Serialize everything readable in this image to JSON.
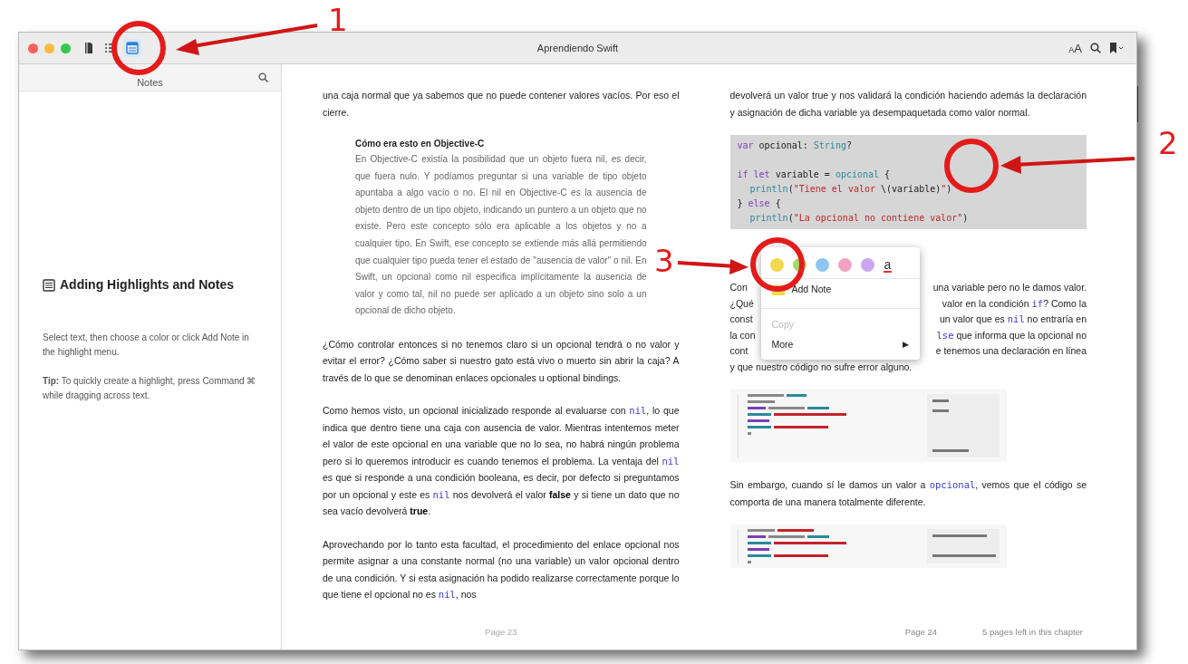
{
  "window": {
    "title": "Aprendiendo Swift"
  },
  "toolbar": {
    "buttons": [
      {
        "kind": "library",
        "selected": false
      },
      {
        "kind": "contents",
        "selected": false
      },
      {
        "kind": "notes",
        "selected": true
      }
    ],
    "font_button": "AA"
  },
  "sidebar": {
    "title": "Notes",
    "heading": "Adding Highlights and Notes",
    "body": "Select text, then choose a color or click Add Note in the highlight menu.",
    "tip": "**Tip:** To quickly create a highlight, press Command ⌘ while dragging across text."
  },
  "left_page": {
    "blocks": [
      {
        "kind": "paragraph",
        "segments": [
          {
            "kind": "plain",
            "text": "una caja normal que ya sabemos que no puede contener valores vacíos. Por eso el cierre."
          }
        ]
      },
      {
        "kind": "aside",
        "title": "Cómo era esto en Objective-C",
        "body": "En Objective-C existía la posibilidad que un objeto fuera nil, es decir, que fuera nulo. Y podíamos preguntar si una variable de tipo objeto apuntaba a algo vacío o no. El nil en Objective-C es la ausencia de objeto dentro de un tipo objeto, indicando un puntero a un objeto que no existe. Pero este concepto sólo era aplicable a los objetos y no a cualquier tipo. En Swift, ese concepto se extiende más allá permitiendo que cualquier tipo pueda tener el estado de \"ausencia de valor\" o nil. En Swift, un opcional como nil especifica implícitamente la ausencia de valor y como tal, nil no puede ser aplicado a un objeto sino solo a un opcional de dicho objeto."
      },
      {
        "kind": "paragraph",
        "segments": [
          {
            "kind": "plain",
            "text": "¿Cómo controlar entonces si no tenemos claro si un opcional tendrá o no valor y evitar el error? ¿Cómo saber si nuestro gato está vivo o muerto sin abrir la caja? A través de lo que se denominan enlaces opcionales u optional bindings."
          }
        ]
      },
      {
        "kind": "paragraph",
        "segments": [
          {
            "kind": "plain",
            "text": "Como hemos visto, un opcional inicializado responde al evaluarse con "
          },
          {
            "kind": "code",
            "text": "nil"
          },
          {
            "kind": "plain",
            "text": ", lo que indica que dentro tiene una caja con ausencia de valor. Mientras intentemos meter el valor de este opcional en una variable que no lo sea, no habrá ningún problema pero si lo queremos introducir es cuando tenemos el problema. La ventaja del "
          },
          {
            "kind": "code",
            "text": "nil"
          },
          {
            "kind": "plain",
            "text": " es que si responde a una condición booleana, es decir, por defecto si preguntamos por un opcional y este es "
          },
          {
            "kind": "code",
            "text": "nil"
          },
          {
            "kind": "plain",
            "text": " nos devolverá el valor "
          },
          {
            "kind": "bold",
            "text": "false"
          },
          {
            "kind": "plain",
            "text": " y si tiene un dato que no sea vacío devolverá "
          },
          {
            "kind": "bold",
            "text": "true"
          },
          {
            "kind": "plain",
            "text": "."
          }
        ]
      },
      {
        "kind": "paragraph",
        "segments": [
          {
            "kind": "plain",
            "text": "Aprovechando por lo tanto esta facultad, el procedimiento del enlace opcional nos permite asignar a una constante normal (no una variable) un valor opcional dentro de una condición. Y si esta asignación ha podido realizarse correctamente porque lo que tiene el opcional no es "
          },
          {
            "kind": "code",
            "text": "nil"
          },
          {
            "kind": "plain",
            "text": ", nos"
          }
        ]
      }
    ],
    "footer": "Page 23"
  },
  "right_page": {
    "blocks": [
      {
        "kind": "paragraph",
        "segments": [
          {
            "kind": "plain",
            "text": "devolverá un valor true y nos validará la condición haciendo además la declaración y asignación de dicha variable ya desempaquetada como valor normal."
          }
        ]
      },
      {
        "kind": "code",
        "lines": [
          {
            "kind": "code",
            "indent": false,
            "segments": [
              {
                "kind": "keyword",
                "text": "var"
              },
              {
                "kind": "plain",
                "text": " opcional: "
              },
              {
                "kind": "type",
                "text": "String"
              },
              {
                "kind": "plain",
                "text": "?"
              }
            ]
          },
          {
            "kind": "blank"
          },
          {
            "kind": "code",
            "indent": false,
            "segments": [
              {
                "kind": "keyword",
                "text": "if let"
              },
              {
                "kind": "plain",
                "text": " variable = "
              },
              {
                "kind": "type",
                "text": "opcional"
              },
              {
                "kind": "plain",
                "text": " {"
              }
            ]
          },
          {
            "kind": "code",
            "indent": true,
            "segments": [
              {
                "kind": "type",
                "text": "println"
              },
              {
                "kind": "plain",
                "text": "("
              },
              {
                "kind": "string",
                "text": "\"Tiene el valor "
              },
              {
                "kind": "plain",
                "text": "\\(variable)"
              },
              {
                "kind": "string",
                "text": "\""
              },
              {
                "kind": "plain",
                "text": ")"
              }
            ]
          },
          {
            "kind": "code",
            "indent": false,
            "segments": [
              {
                "kind": "plain",
                "text": "} "
              },
              {
                "kind": "keyword",
                "text": "else"
              },
              {
                "kind": "plain",
                "text": " {"
              }
            ]
          },
          {
            "kind": "code",
            "indent": true,
            "segments": [
              {
                "kind": "type",
                "text": "println"
              },
              {
                "kind": "plain",
                "text": "("
              },
              {
                "kind": "string",
                "text": "\"La opcional no contiene valor\""
              },
              {
                "kind": "plain",
                "text": ")"
              }
            ]
          }
        ]
      },
      {
        "kind": "covered",
        "lines": [
          {
            "left": "Con",
            "right": [
              {
                "kind": "plain",
                "text": "una variable pero no le damos valor."
              }
            ]
          },
          {
            "left": "¿Qué",
            "right": [
              {
                "kind": "plain",
                "text": "valor en la condición "
              },
              {
                "kind": "code",
                "text": "if"
              },
              {
                "kind": "plain",
                "text": "? Como la"
              }
            ]
          },
          {
            "left": "const",
            "right": [
              {
                "kind": "plain",
                "text": "un valor que es "
              },
              {
                "kind": "code",
                "text": "nil"
              },
              {
                "kind": "plain",
                "text": " no entraría en"
              }
            ]
          },
          {
            "left": "la con",
            "right": [
              {
                "kind": "code",
                "text": "lse"
              },
              {
                "kind": "plain",
                "text": " que informa que la opcional no"
              }
            ]
          },
          {
            "left": "cont",
            "right": [
              {
                "kind": "plain",
                "text": "e tenemos una declaración en línea"
              }
            ]
          },
          {
            "left": "y que nuestro código no sufre error alguno."
          }
        ]
      },
      {
        "kind": "screenshot"
      },
      {
        "kind": "paragraph",
        "segments": [
          {
            "kind": "plain",
            "text": "Sin embargo, cuando sí le damos un valor a "
          },
          {
            "kind": "code",
            "text": "opcional"
          },
          {
            "kind": "plain",
            "text": ", vemos que el código se comporta de una manera totalmente diferente."
          }
        ]
      },
      {
        "kind": "screenshot"
      }
    ],
    "footer": "Page 24",
    "remaining": "5 pages left in this chapter"
  },
  "context_menu": {
    "colors": [
      {
        "color": "#f2d94e"
      },
      {
        "color": "#a6d86a"
      },
      {
        "color": "#8ec5f2"
      },
      {
        "color": "#f2a3c4"
      },
      {
        "color": "#c9a6ee"
      }
    ],
    "underline_glyph": "a",
    "items": [
      {
        "kind": "note",
        "label": "Add Note",
        "disabled": false
      },
      {
        "kind": "plain",
        "label": "Copy",
        "disabled": true
      },
      {
        "kind": "submenu",
        "label": "More",
        "arrow": "▶",
        "disabled": false
      }
    ]
  },
  "annotations": [
    {
      "label": "1"
    },
    {
      "label": "2"
    },
    {
      "label": "3"
    }
  ]
}
